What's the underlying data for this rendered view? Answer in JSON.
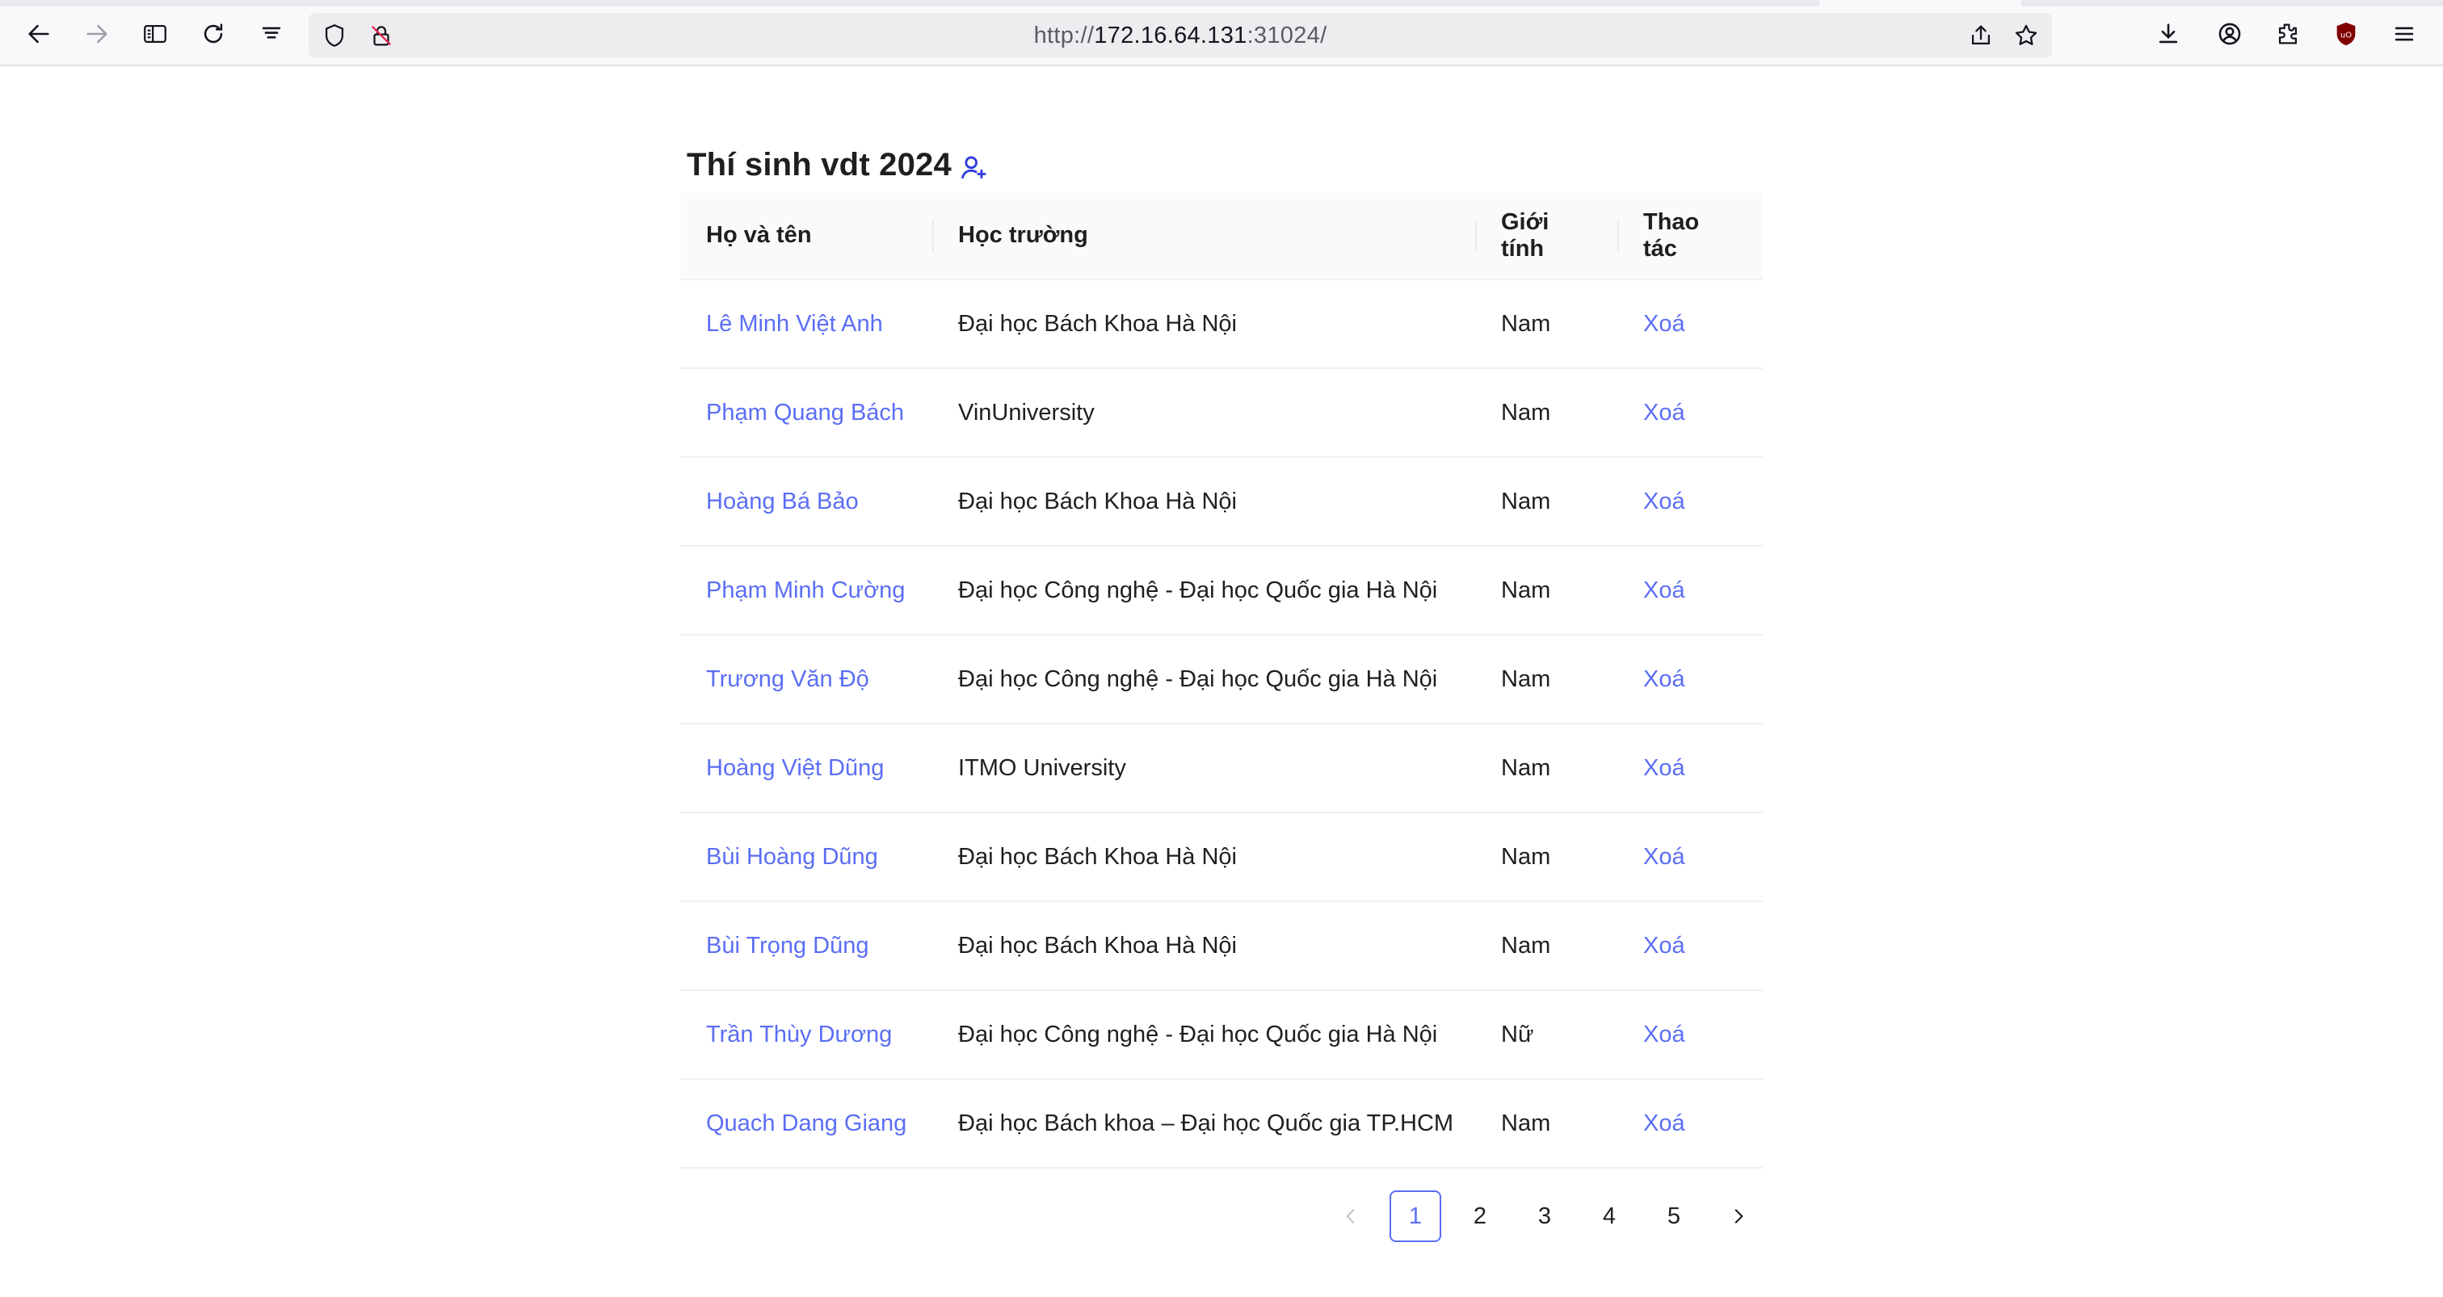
{
  "browser": {
    "url_prefix": "http://",
    "url_host": "172.16.64.131",
    "url_suffix": ":31024/"
  },
  "page": {
    "title": "Thí sinh vdt 2024",
    "columns": [
      "Họ và tên",
      "Học trường",
      "Giới tính",
      "Thao tác"
    ],
    "rows": [
      {
        "name": "Lê Minh Việt Anh",
        "school": "Đại học Bách Khoa Hà Nội",
        "gender": "Nam",
        "action": "Xoá"
      },
      {
        "name": "Phạm Quang Bách",
        "school": "VinUniversity",
        "gender": "Nam",
        "action": "Xoá"
      },
      {
        "name": "Hoàng Bá Bảo",
        "school": "Đại học Bách Khoa Hà Nội",
        "gender": "Nam",
        "action": "Xoá"
      },
      {
        "name": "Phạm Minh Cường",
        "school": "Đại học Công nghệ - Đại học Quốc gia Hà Nội",
        "gender": "Nam",
        "action": "Xoá"
      },
      {
        "name": "Trương Văn Độ",
        "school": "Đại học Công nghệ - Đại học Quốc gia Hà Nội",
        "gender": "Nam",
        "action": "Xoá"
      },
      {
        "name": "Hoàng Việt Dũng",
        "school": "ITMO University",
        "gender": "Nam",
        "action": "Xoá"
      },
      {
        "name": "Bùi Hoàng Dũng",
        "school": "Đại học Bách Khoa Hà Nội",
        "gender": "Nam",
        "action": "Xoá"
      },
      {
        "name": "Bùi Trọng Dũng",
        "school": "Đại học Bách Khoa Hà Nội",
        "gender": "Nam",
        "action": "Xoá"
      },
      {
        "name": "Trần Thùy Dương",
        "school": "Đại học Công nghệ - Đại học Quốc gia Hà Nội",
        "gender": "Nữ",
        "action": "Xoá"
      },
      {
        "name": "Quach Dang Giang",
        "school": "Đại học Bách khoa – Đại học Quốc gia TP.HCM",
        "gender": "Nam",
        "action": "Xoá"
      }
    ],
    "pagination": {
      "pages": [
        "1",
        "2",
        "3",
        "4",
        "5"
      ],
      "current": "1"
    }
  },
  "colors": {
    "link": "#5b6ef5",
    "header_bg": "#fafafa"
  }
}
